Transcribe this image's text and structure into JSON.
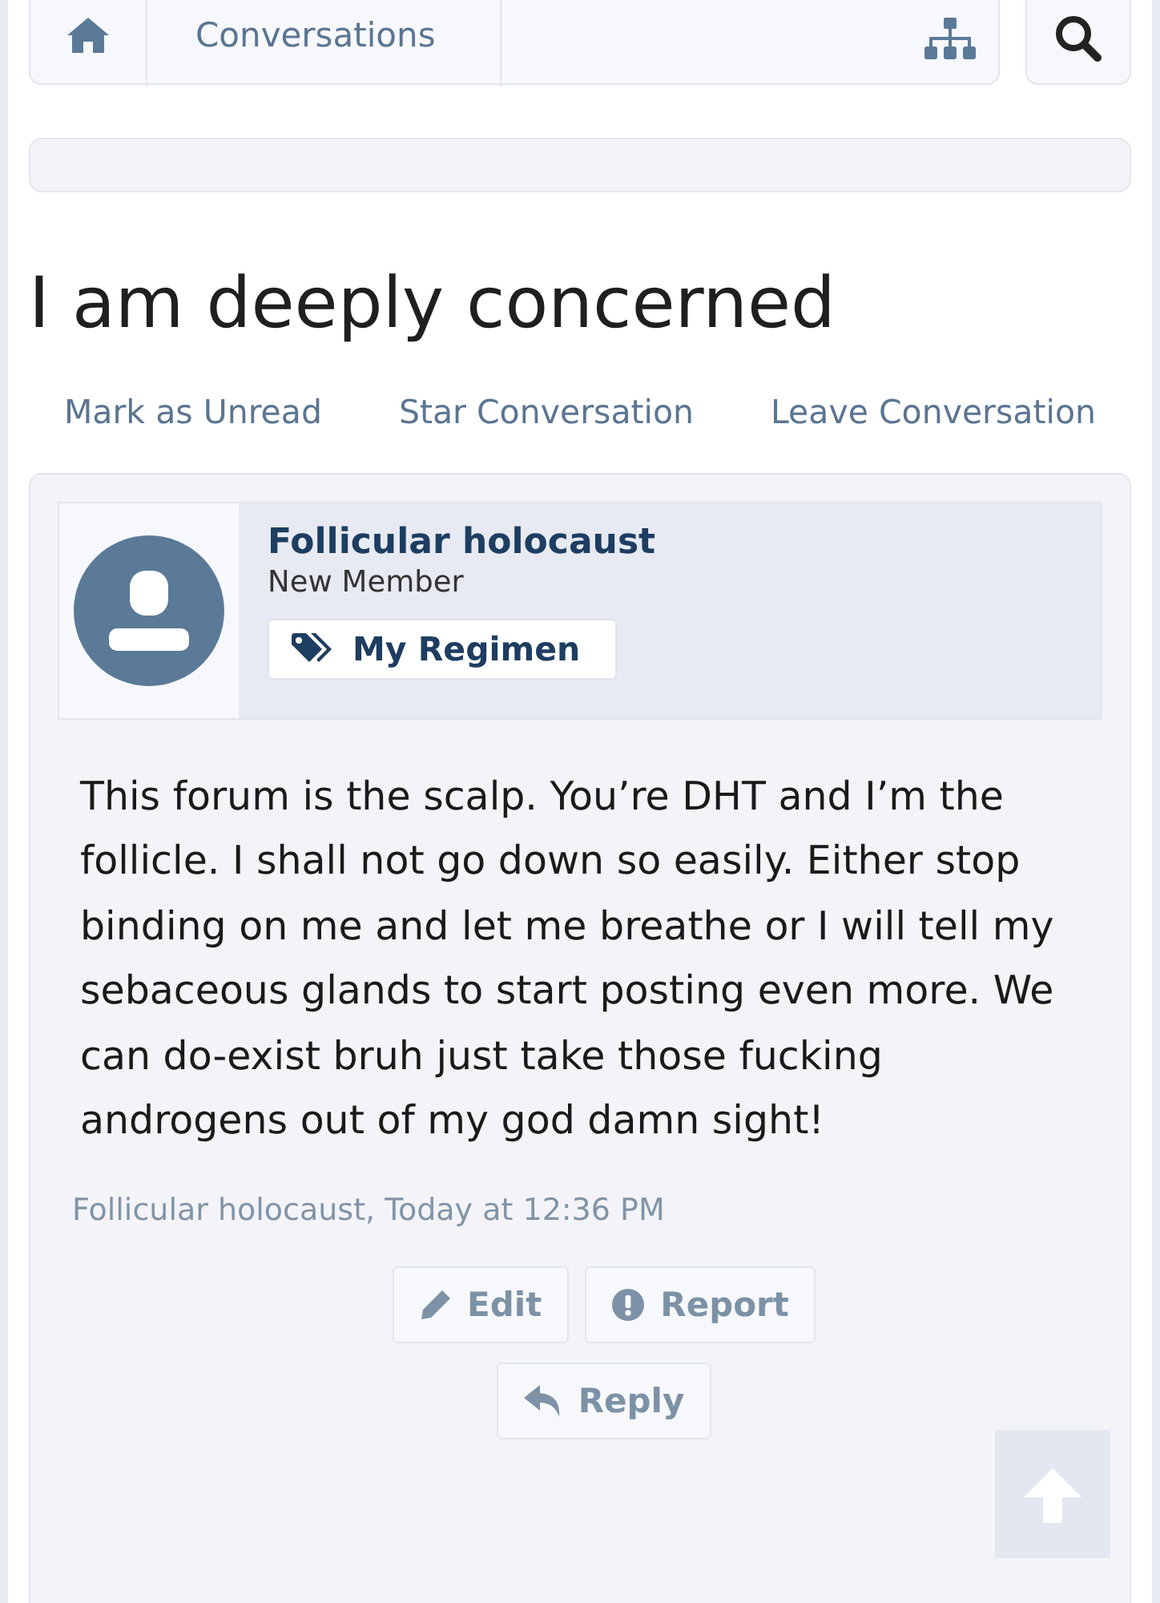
{
  "breadcrumb": {
    "items": [
      {
        "kind": "home"
      },
      {
        "kind": "text",
        "label": "Conversations"
      }
    ]
  },
  "title": "I am deeply concerned",
  "actions": [
    "Mark as Unread",
    "Star Conversation",
    "Leave Conversation"
  ],
  "message": {
    "author": "Follicular holocaust",
    "role": "New Member",
    "tag": "My Regimen",
    "body": "This forum is the scalp. You’re DHT and I’m the follicle. I shall not go down so easily. Either stop binding on me and let me breathe or I will tell my sebaceous glands to start posting even more. We can do-exist bruh just take those fucking androgens out of my god damn sight!",
    "meta": "Follicular holocaust, Today at 12:36 PM",
    "buttons": [
      {
        "kind": "edit",
        "label": "Edit"
      },
      {
        "kind": "report",
        "label": "Report"
      },
      {
        "kind": "reply",
        "label": "Reply"
      }
    ]
  }
}
